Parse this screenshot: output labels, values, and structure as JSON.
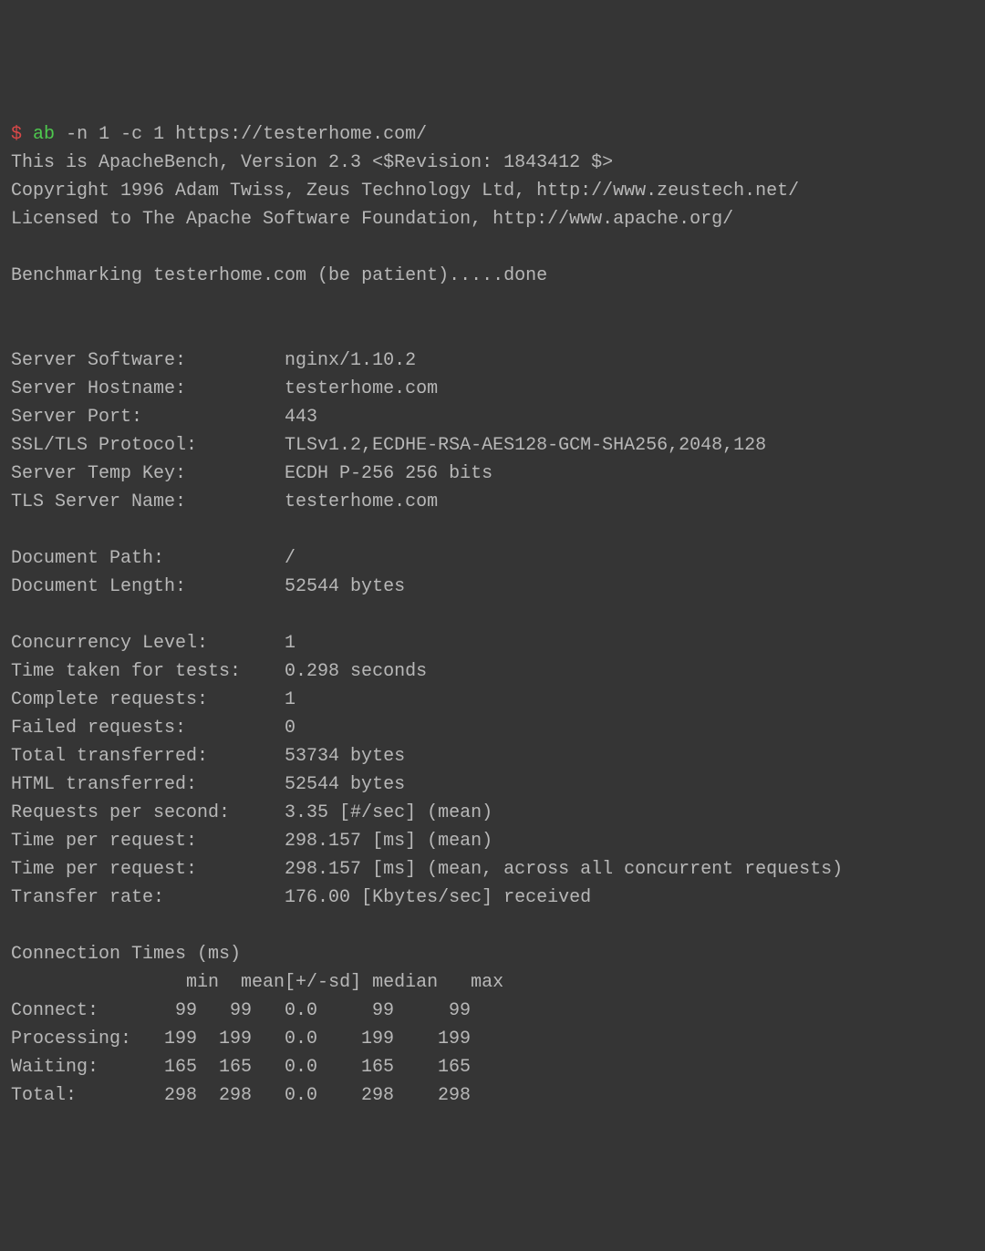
{
  "prompt": {
    "dollar": "$",
    "command": "ab",
    "args": "-n 1 -c 1 https://testerhome.com/"
  },
  "header": {
    "line1": "This is ApacheBench, Version 2.3 <$Revision: 1843412 $>",
    "line2": "Copyright 1996 Adam Twiss, Zeus Technology Ltd, http://www.zeustech.net/",
    "line3": "Licensed to The Apache Software Foundation, http://www.apache.org/"
  },
  "benchmarking": "Benchmarking testerhome.com (be patient).....done",
  "server_info": {
    "software": {
      "label": "Server Software:",
      "value": "nginx/1.10.2"
    },
    "hostname": {
      "label": "Server Hostname:",
      "value": "testerhome.com"
    },
    "port": {
      "label": "Server Port:",
      "value": "443"
    },
    "ssl": {
      "label": "SSL/TLS Protocol:",
      "value": "TLSv1.2,ECDHE-RSA-AES128-GCM-SHA256,2048,128"
    },
    "tempkey": {
      "label": "Server Temp Key:",
      "value": "ECDH P-256 256 bits"
    },
    "tlsname": {
      "label": "TLS Server Name:",
      "value": "testerhome.com"
    }
  },
  "document": {
    "path": {
      "label": "Document Path:",
      "value": "/"
    },
    "length": {
      "label": "Document Length:",
      "value": "52544 bytes"
    }
  },
  "stats": {
    "concurrency": {
      "label": "Concurrency Level:",
      "value": "1"
    },
    "time_taken": {
      "label": "Time taken for tests:",
      "value": "0.298 seconds"
    },
    "complete": {
      "label": "Complete requests:",
      "value": "1"
    },
    "failed": {
      "label": "Failed requests:",
      "value": "0"
    },
    "total_transferred": {
      "label": "Total transferred:",
      "value": "53734 bytes"
    },
    "html_transferred": {
      "label": "HTML transferred:",
      "value": "52544 bytes"
    },
    "rps": {
      "label": "Requests per second:",
      "value": "3.35 [#/sec] (mean)"
    },
    "tpr1": {
      "label": "Time per request:",
      "value": "298.157 [ms] (mean)"
    },
    "tpr2": {
      "label": "Time per request:",
      "value": "298.157 [ms] (mean, across all concurrent requests)"
    },
    "transfer_rate": {
      "label": "Transfer rate:",
      "value": "176.00 [Kbytes/sec] received"
    }
  },
  "conn_times": {
    "title": "Connection Times (ms)",
    "header": {
      "blank": "",
      "min": "min",
      "mean": "mean",
      "sd": "[+/-sd]",
      "median": "median",
      "max": "max"
    },
    "mean_sd_header": "mean[+/-sd]",
    "rows": {
      "connect": {
        "label": "Connect:",
        "min": "99",
        "mean": "99",
        "sd": "0.0",
        "median": "99",
        "max": "99"
      },
      "processing": {
        "label": "Processing:",
        "min": "199",
        "mean": "199",
        "sd": "0.0",
        "median": "199",
        "max": "199"
      },
      "waiting": {
        "label": "Waiting:",
        "min": "165",
        "mean": "165",
        "sd": "0.0",
        "median": "165",
        "max": "165"
      },
      "total": {
        "label": "Total:",
        "min": "298",
        "mean": "298",
        "sd": "0.0",
        "median": "298",
        "max": "298"
      }
    }
  }
}
